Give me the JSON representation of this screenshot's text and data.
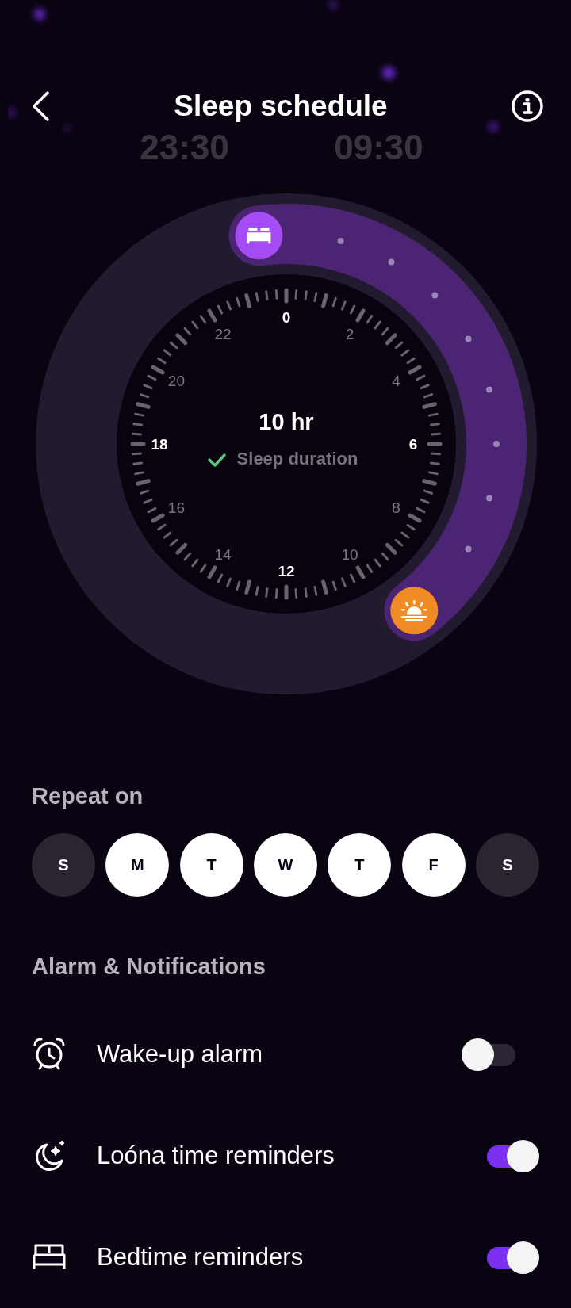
{
  "header": {
    "title": "Sleep schedule"
  },
  "times": [
    {
      "text": "23:30"
    },
    {
      "text": "09:30"
    }
  ],
  "clock": {
    "hour_labels": [
      {
        "text": "0",
        "major": true
      },
      {
        "text": "2",
        "major": false
      },
      {
        "text": "4",
        "major": false
      },
      {
        "text": "6",
        "major": true
      },
      {
        "text": "8",
        "major": false
      },
      {
        "text": "10",
        "major": false
      },
      {
        "text": "12",
        "major": true
      },
      {
        "text": "14",
        "major": false
      },
      {
        "text": "16",
        "major": false
      },
      {
        "text": "18",
        "major": true
      },
      {
        "text": "20",
        "major": false
      },
      {
        "text": "22",
        "major": false
      }
    ],
    "duration": "10 hr",
    "duration_caption": "Sleep duration"
  },
  "repeat": {
    "title": "Repeat on",
    "days": [
      {
        "label": "S",
        "selected": false
      },
      {
        "label": "M",
        "selected": true
      },
      {
        "label": "T",
        "selected": true
      },
      {
        "label": "W",
        "selected": true
      },
      {
        "label": "T",
        "selected": true
      },
      {
        "label": "F",
        "selected": true
      },
      {
        "label": "S",
        "selected": false
      }
    ]
  },
  "notifications": {
    "title": "Alarm & Notifications",
    "items": [
      {
        "kind": "alarm",
        "label": "Wake-up alarm",
        "on": false
      },
      {
        "kind": "moon",
        "label": "Loóna time reminders",
        "on": true
      },
      {
        "kind": "bed",
        "label": "Bedtime reminders",
        "on": true
      }
    ]
  }
}
